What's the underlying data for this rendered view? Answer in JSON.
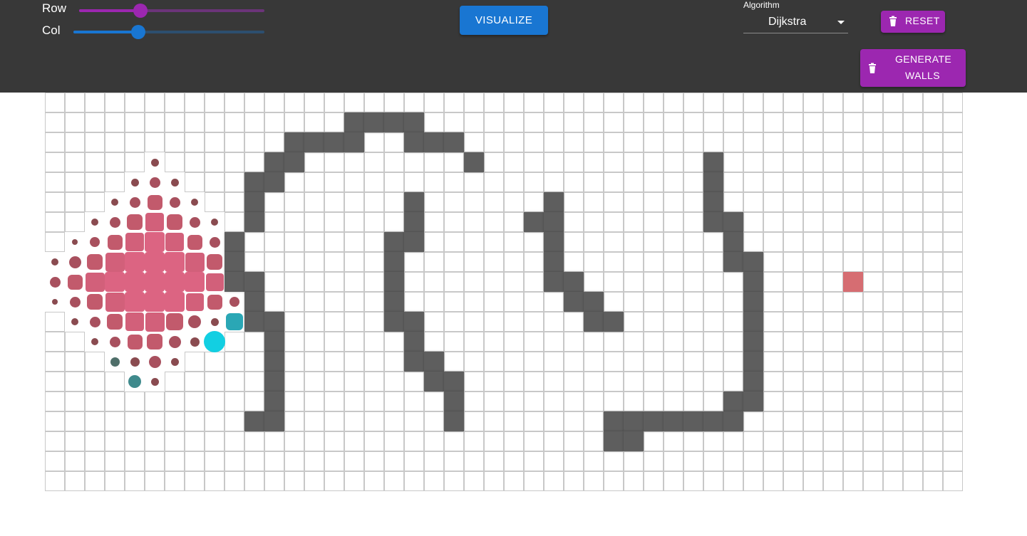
{
  "controls": {
    "row_label": "Row",
    "col_label": "Col",
    "row_value_fraction": 0.33,
    "col_value_fraction": 0.34,
    "row_color": "#9c27b0",
    "col_color": "#1976d2"
  },
  "visualize": {
    "label": "VISUALIZE"
  },
  "algorithm": {
    "label": "Algorithm",
    "value": "Dijkstra"
  },
  "reset": {
    "label": "RESET",
    "icon": "trash-icon"
  },
  "generate": {
    "line1": "GENERATE",
    "line2": "WALLS",
    "icon": "trash-icon"
  },
  "grid": {
    "rows": 20,
    "cols": 46,
    "walls": [
      [
        1,
        15
      ],
      [
        1,
        16
      ],
      [
        1,
        17
      ],
      [
        1,
        18
      ],
      [
        2,
        12
      ],
      [
        2,
        13
      ],
      [
        2,
        14
      ],
      [
        2,
        15
      ],
      [
        2,
        18
      ],
      [
        2,
        19
      ],
      [
        2,
        20
      ],
      [
        3,
        11
      ],
      [
        3,
        12
      ],
      [
        3,
        21
      ],
      [
        3,
        33
      ],
      [
        4,
        10
      ],
      [
        4,
        11
      ],
      [
        4,
        33
      ],
      [
        5,
        10
      ],
      [
        5,
        18
      ],
      [
        5,
        25
      ],
      [
        5,
        33
      ],
      [
        6,
        10
      ],
      [
        6,
        18
      ],
      [
        6,
        24
      ],
      [
        6,
        25
      ],
      [
        6,
        33
      ],
      [
        6,
        34
      ],
      [
        7,
        9
      ],
      [
        7,
        17
      ],
      [
        7,
        18
      ],
      [
        7,
        25
      ],
      [
        7,
        34
      ],
      [
        8,
        9
      ],
      [
        8,
        17
      ],
      [
        8,
        25
      ],
      [
        8,
        34
      ],
      [
        8,
        35
      ],
      [
        9,
        9
      ],
      [
        9,
        10
      ],
      [
        9,
        17
      ],
      [
        9,
        25
      ],
      [
        9,
        26
      ],
      [
        9,
        35
      ],
      [
        10,
        10
      ],
      [
        10,
        17
      ],
      [
        10,
        26
      ],
      [
        10,
        27
      ],
      [
        10,
        35
      ],
      [
        11,
        10
      ],
      [
        11,
        11
      ],
      [
        11,
        17
      ],
      [
        11,
        18
      ],
      [
        11,
        27
      ],
      [
        11,
        28
      ],
      [
        11,
        35
      ],
      [
        12,
        11
      ],
      [
        12,
        18
      ],
      [
        12,
        35
      ],
      [
        13,
        11
      ],
      [
        13,
        18
      ],
      [
        13,
        19
      ],
      [
        13,
        35
      ],
      [
        14,
        11
      ],
      [
        14,
        19
      ],
      [
        14,
        20
      ],
      [
        14,
        35
      ],
      [
        15,
        11
      ],
      [
        15,
        20
      ],
      [
        15,
        34
      ],
      [
        15,
        35
      ],
      [
        16,
        10
      ],
      [
        16,
        11
      ],
      [
        16,
        20
      ],
      [
        16,
        28
      ],
      [
        16,
        29
      ],
      [
        16,
        30
      ],
      [
        16,
        31
      ],
      [
        16,
        32
      ],
      [
        16,
        33
      ],
      [
        16,
        34
      ],
      [
        17,
        28
      ],
      [
        17,
        29
      ]
    ],
    "target": [
      9,
      40
    ],
    "start": [
      12,
      8
    ],
    "visited_dots": [
      [
        3,
        5,
        0.4,
        "#8a4b50"
      ],
      [
        4,
        4,
        0.4,
        "#8a4b50"
      ],
      [
        4,
        5,
        0.55,
        "#a8505e"
      ],
      [
        4,
        6,
        0.4,
        "#8a4b50"
      ],
      [
        5,
        3,
        0.35,
        "#8a4b50"
      ],
      [
        5,
        4,
        0.55,
        "#a8505e"
      ],
      [
        5,
        5,
        0.75,
        "#c25a6c"
      ],
      [
        5,
        6,
        0.55,
        "#a8505e"
      ],
      [
        5,
        7,
        0.35,
        "#8a4b50"
      ],
      [
        6,
        2,
        0.35,
        "#8a4b50"
      ],
      [
        6,
        3,
        0.55,
        "#a8505e"
      ],
      [
        6,
        4,
        0.8,
        "#c25a6c"
      ],
      [
        6,
        5,
        0.92,
        "#d2607a"
      ],
      [
        6,
        6,
        0.8,
        "#c25a6c"
      ],
      [
        6,
        7,
        0.55,
        "#a8505e"
      ],
      [
        6,
        8,
        0.35,
        "#8a4b50"
      ],
      [
        7,
        1,
        0.3,
        "#8a4b50"
      ],
      [
        7,
        2,
        0.5,
        "#a8505e"
      ],
      [
        7,
        3,
        0.75,
        "#c25a6c"
      ],
      [
        7,
        4,
        0.92,
        "#d2607a"
      ],
      [
        7,
        5,
        1.0,
        "#dc6482"
      ],
      [
        7,
        6,
        0.92,
        "#d2607a"
      ],
      [
        7,
        7,
        0.75,
        "#c25a6c"
      ],
      [
        7,
        8,
        0.55,
        "#a8505e"
      ],
      [
        8,
        0,
        0.35,
        "#8a4b50"
      ],
      [
        8,
        1,
        0.6,
        "#a8505e"
      ],
      [
        8,
        2,
        0.8,
        "#c25a6c"
      ],
      [
        8,
        3,
        0.95,
        "#d2607a"
      ],
      [
        8,
        4,
        1.0,
        "#dc6482"
      ],
      [
        8,
        5,
        1.0,
        "#dc6482"
      ],
      [
        8,
        6,
        1.0,
        "#dc6482"
      ],
      [
        8,
        7,
        0.95,
        "#d2607a"
      ],
      [
        8,
        8,
        0.8,
        "#c25a6c"
      ],
      [
        9,
        0,
        0.55,
        "#a8505e"
      ],
      [
        9,
        1,
        0.75,
        "#c25a6c"
      ],
      [
        9,
        2,
        0.95,
        "#d2607a"
      ],
      [
        9,
        3,
        1.0,
        "#dc6482"
      ],
      [
        9,
        4,
        1.0,
        "#dc6482"
      ],
      [
        9,
        5,
        1.0,
        "#dc6482"
      ],
      [
        9,
        6,
        1.0,
        "#dc6482"
      ],
      [
        9,
        7,
        1.0,
        "#dc6482"
      ],
      [
        9,
        8,
        0.9,
        "#d2607a"
      ],
      [
        10,
        0,
        0.3,
        "#8a4b50"
      ],
      [
        10,
        1,
        0.55,
        "#a8505e"
      ],
      [
        10,
        2,
        0.8,
        "#c25a6c"
      ],
      [
        10,
        3,
        0.95,
        "#d2607a"
      ],
      [
        10,
        4,
        1.0,
        "#dc6482"
      ],
      [
        10,
        5,
        1.0,
        "#dc6482"
      ],
      [
        10,
        6,
        1.0,
        "#dc6482"
      ],
      [
        10,
        7,
        0.9,
        "#d2607a"
      ],
      [
        10,
        8,
        0.75,
        "#c25a6c"
      ],
      [
        10,
        9,
        0.5,
        "#a8505e"
      ],
      [
        11,
        1,
        0.35,
        "#8a4b50"
      ],
      [
        11,
        2,
        0.55,
        "#a8505e"
      ],
      [
        11,
        3,
        0.8,
        "#c25a6c"
      ],
      [
        11,
        4,
        0.92,
        "#d2607a"
      ],
      [
        11,
        5,
        0.95,
        "#d2607a"
      ],
      [
        11,
        6,
        0.85,
        "#c25a6c"
      ],
      [
        11,
        7,
        0.65,
        "#a8505e"
      ],
      [
        11,
        8,
        0.4,
        "#8a4b50"
      ],
      [
        12,
        2,
        0.35,
        "#8a4b50"
      ],
      [
        12,
        3,
        0.55,
        "#a8505e"
      ],
      [
        12,
        4,
        0.75,
        "#c25a6c"
      ],
      [
        12,
        5,
        0.8,
        "#c25a6c"
      ],
      [
        12,
        6,
        0.6,
        "#a8505e"
      ],
      [
        12,
        7,
        0.45,
        "#8a4b50"
      ],
      [
        13,
        3,
        0.45,
        "#4f6f6a"
      ],
      [
        13,
        4,
        0.45,
        "#8a4b50"
      ],
      [
        13,
        5,
        0.6,
        "#a8505e"
      ],
      [
        13,
        6,
        0.4,
        "#8a4b50"
      ],
      [
        14,
        4,
        0.65,
        "#3f8a8c"
      ],
      [
        14,
        5,
        0.4,
        "#8a4b50"
      ],
      [
        11,
        9,
        0.85,
        "#2aa7b5"
      ]
    ]
  }
}
